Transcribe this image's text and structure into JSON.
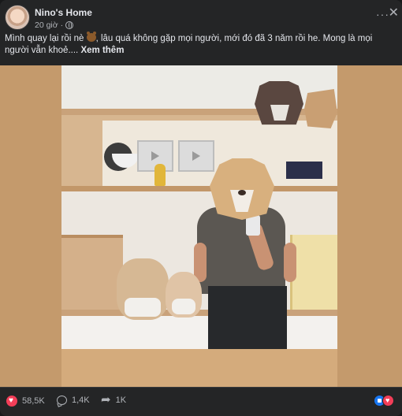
{
  "post": {
    "page_name": "Nino's Home",
    "time": "20 giờ",
    "privacy_icon": "globe-icon",
    "more_icon": "more-horizontal-icon",
    "close_icon": "close-icon",
    "caption_part1": "Mình quay lại rồi nè",
    "caption_emoji": "bear-emoji",
    "caption_part2": ", lâu quá không gặp mọi người, mới đó đã 3 năm rồi he. Mong là mọi người vẫn khoẻ....",
    "see_more": "Xem thêm"
  },
  "footer": {
    "reactions_count": "58,5K",
    "comments_count": "1,4K",
    "shares_count": "1K",
    "reaction_icons": [
      "like-icon",
      "love-icon"
    ]
  },
  "colors": {
    "background": "#242526",
    "text_primary": "#e4e6eb",
    "text_secondary": "#b0b3b8",
    "love": "#f33e58",
    "like": "#1877f2"
  }
}
